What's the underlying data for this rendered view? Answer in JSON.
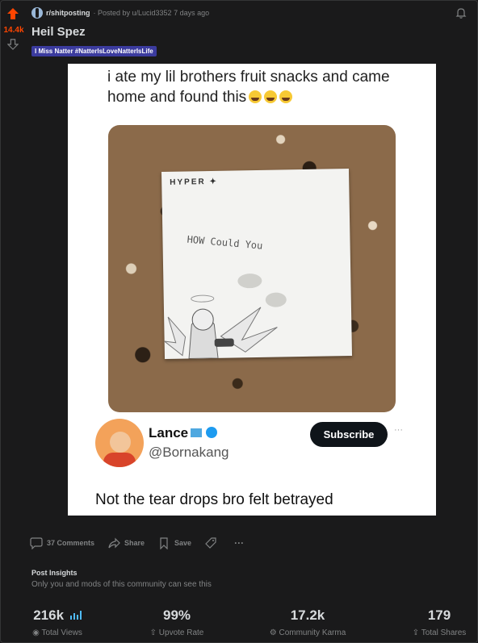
{
  "post": {
    "subreddit": "r/shitposting",
    "posted_by": "· Posted by u/Lucid3352 7 days ago",
    "score": "14.4k",
    "title": "Heil Spez",
    "flair": "I Miss Natter #NatterIsLoveNatterIsLife"
  },
  "image": {
    "caption": "i ate my lil brothers fruit snacks and came home and found this",
    "note_brand": "HYPER",
    "note_text": "HOW Could You",
    "profile_name": "Lance",
    "profile_handle": "@Bornakang",
    "subscribe_label": "Subscribe",
    "more_label": "···",
    "quote": "Not the tear drops bro felt betrayed"
  },
  "actions": {
    "comments": "37 Comments",
    "share": "Share",
    "save": "Save",
    "more": "···"
  },
  "insights": {
    "title": "Post Insights",
    "subtitle": "Only you and mods of this community can see this",
    "stats": [
      {
        "value": "216k",
        "label": "Total Views"
      },
      {
        "value": "99%",
        "label": "Upvote Rate"
      },
      {
        "value": "17.2k",
        "label": "Community Karma"
      },
      {
        "value": "179",
        "label": "Total Shares"
      }
    ]
  },
  "colors": {
    "background": "#1a1a1b",
    "upvote": "#ff4500",
    "flair_bg": "#3b3b9e",
    "chart_icon": "#4fbcff"
  }
}
